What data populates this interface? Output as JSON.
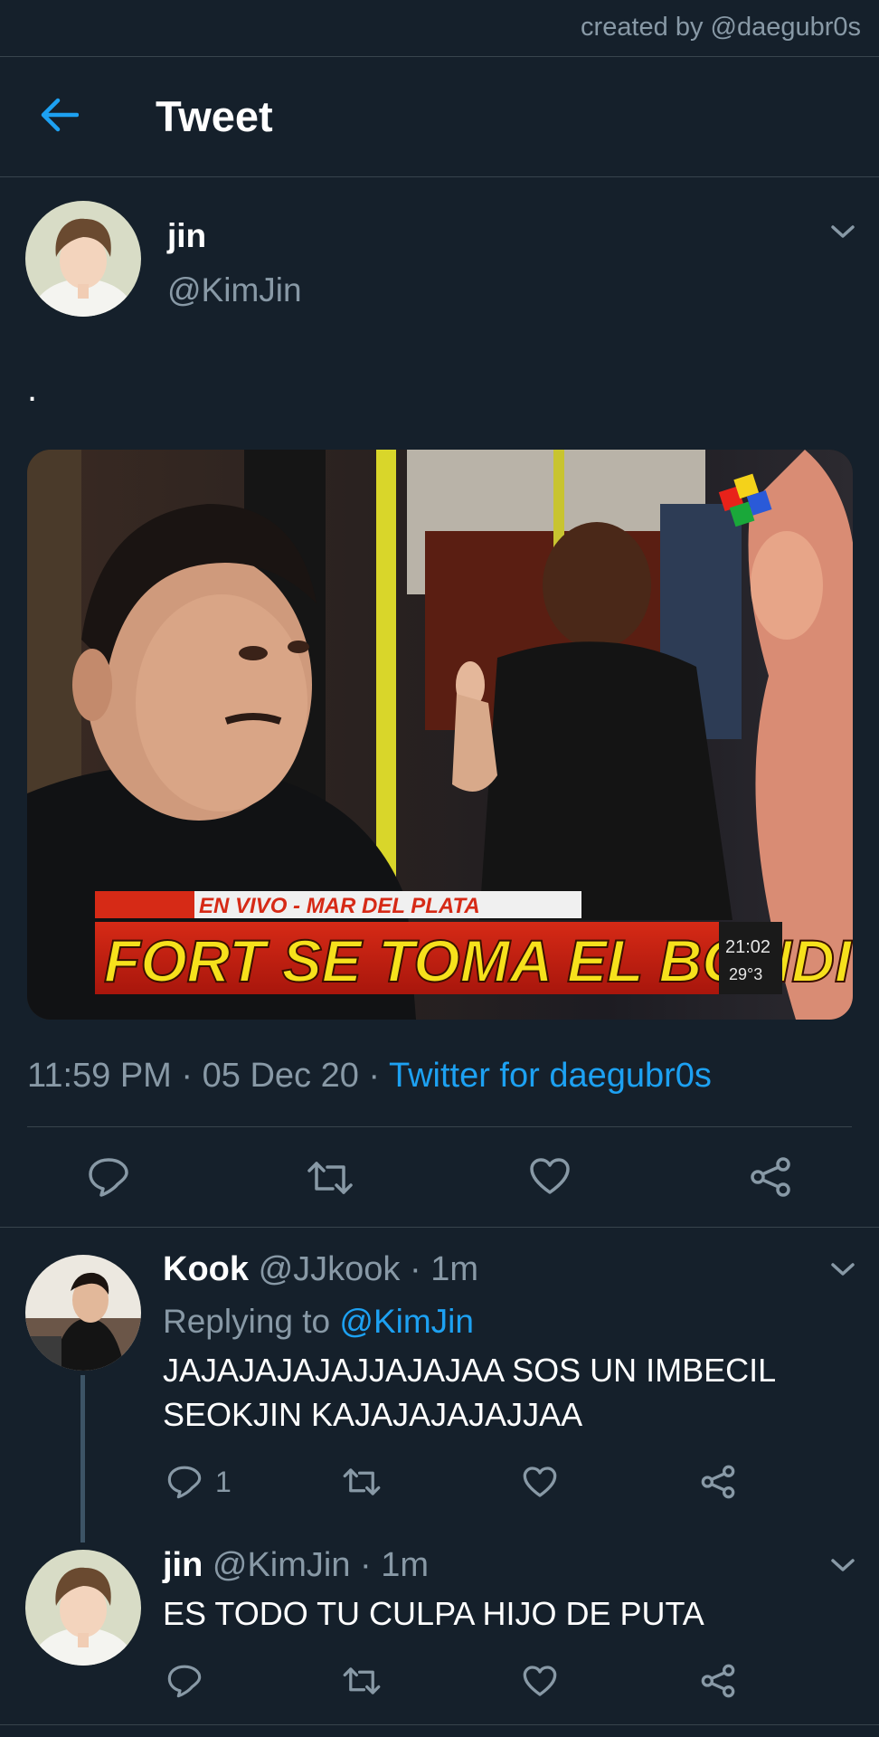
{
  "credit": "created by @daegubr0s",
  "header": {
    "title": "Tweet",
    "back_icon": "arrow-left-icon",
    "accent": "#1da1f2"
  },
  "main_tweet": {
    "name": "jin",
    "handle": "@KimJin",
    "text": ".",
    "media": {
      "caption_small": "EN VIVO - MAR DEL PLATA",
      "caption": "FORT SE TOMA EL BONDI",
      "clock": "21:02",
      "temperature": "29°3"
    },
    "time": "11:59 PM",
    "date": "05 Dec 20",
    "source": "Twitter for daegubr0s",
    "sep": "·"
  },
  "replies": [
    {
      "name": "Kook",
      "handle": "@JJkook",
      "time": "1m",
      "replying_label": "Replying to",
      "replying_to": "@KimJin",
      "text_line1": "JAJAJAJAJAJJAJAJAA SOS UN IMBECIL",
      "text_line2": "SEOKJIN KAJAJAJAJAJJAA",
      "reply_count": "1"
    },
    {
      "name": "jin",
      "handle": "@KimJin",
      "time": "1m",
      "text": "ES TODO TU CULPA HIJO DE PUTA"
    }
  ],
  "colors": {
    "background": "#15202b",
    "muted": "#8899a6",
    "divider": "#38444d",
    "link": "#1da1f2"
  }
}
